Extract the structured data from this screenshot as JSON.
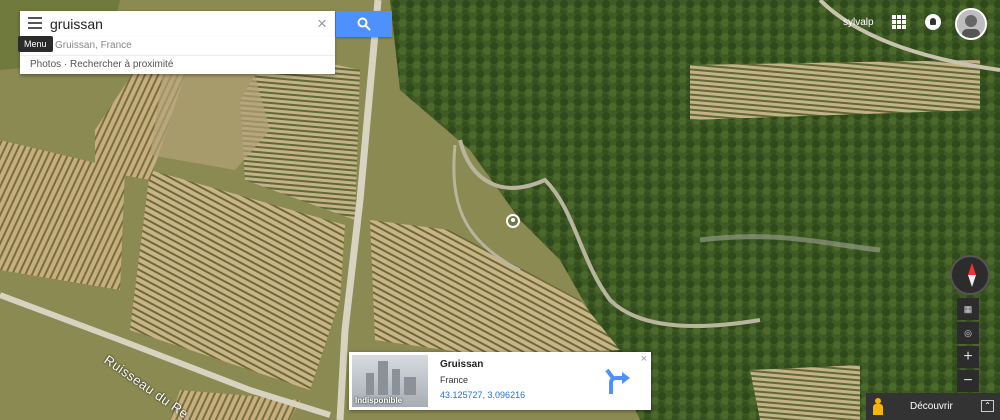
{
  "search": {
    "query": "gruissan",
    "suggestion_primary": "Gruissan, France",
    "suggestion_secondary": "Photos · Rechercher à proximité"
  },
  "menu_tooltip": "Menu",
  "account": {
    "username": "sylvalp"
  },
  "map": {
    "road_label": "Ruisseau du Re"
  },
  "info_card": {
    "title": "Gruissan",
    "subtitle": "France",
    "coordinates": "43.125727, 3.096216",
    "thumbnail_label": "Indisponible",
    "close_symbol": "×"
  },
  "controls": {
    "zoom_in": "+",
    "zoom_out": "−"
  },
  "discover": {
    "label": "Découvrir",
    "expand_symbol": "⌃"
  },
  "icons": [
    "menu-icon",
    "search-icon",
    "clear-icon",
    "apps-icon",
    "notifications-icon",
    "compass-icon",
    "layers-icon",
    "my-location-icon",
    "directions-icon",
    "pegman-icon"
  ],
  "colors": {
    "search_button": "#4d90fe",
    "directions_arrow": "#4d90fe"
  }
}
